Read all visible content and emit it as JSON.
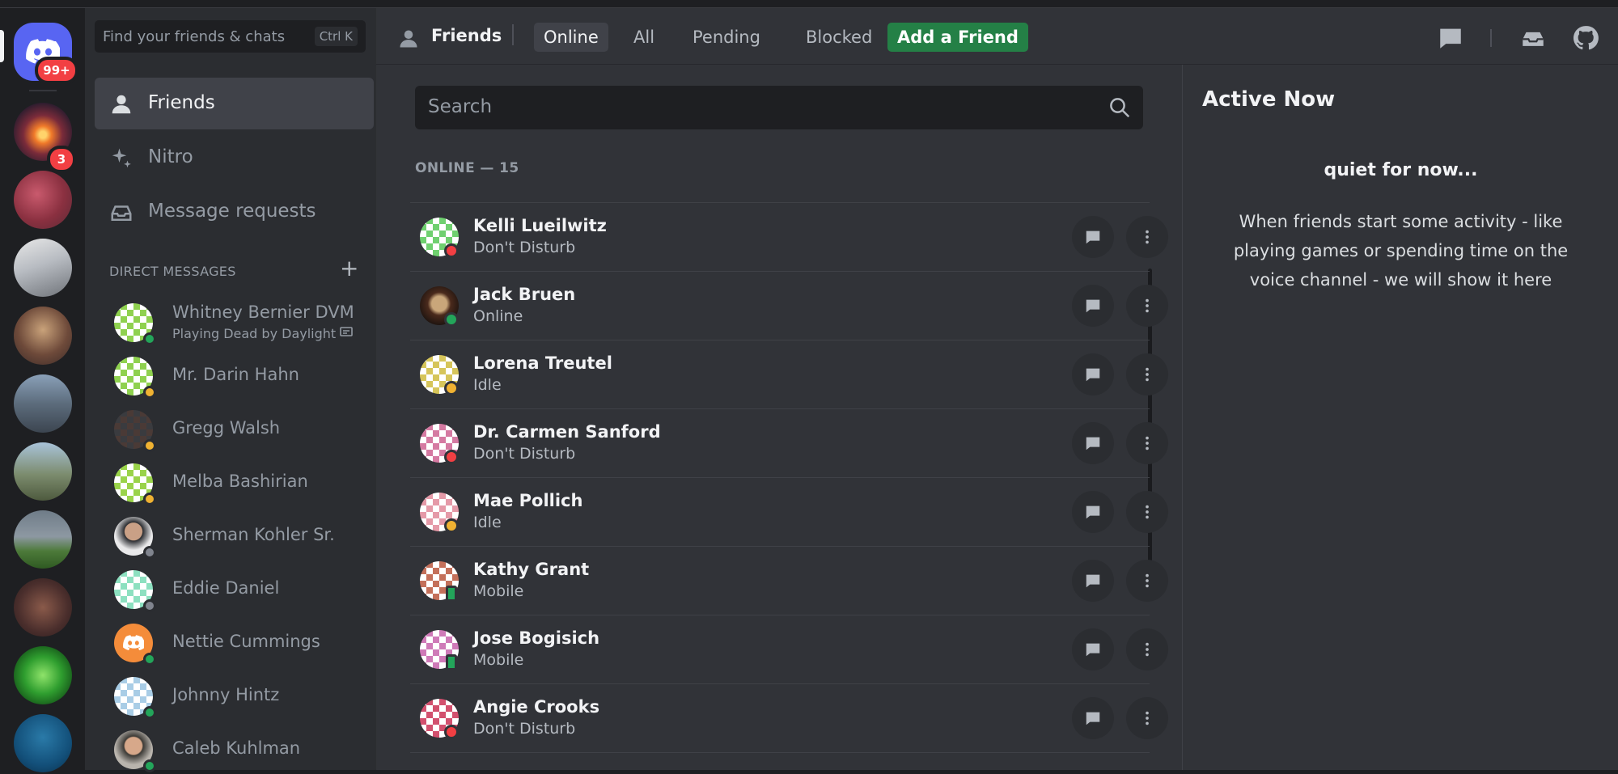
{
  "search": {
    "placeholder": "Find your friends & chats",
    "shortcut": "Ctrl K"
  },
  "rail": {
    "home_badge": "99+",
    "servers": [
      {
        "name": "server-sunset",
        "badge": "3"
      },
      {
        "name": "server-red-flowers"
      },
      {
        "name": "server-white-building"
      },
      {
        "name": "server-market"
      },
      {
        "name": "server-city"
      },
      {
        "name": "server-cliff"
      },
      {
        "name": "server-field"
      },
      {
        "name": "server-crowd"
      },
      {
        "name": "server-green"
      },
      {
        "name": "server-blue"
      }
    ]
  },
  "sidebar": {
    "nav": [
      {
        "label": "Friends",
        "icon": "person-icon"
      },
      {
        "label": "Nitro",
        "icon": "sparkle-icon"
      },
      {
        "label": "Message requests",
        "icon": "inbox-icon"
      }
    ],
    "dm_header": "DIRECT MESSAGES",
    "dms": [
      {
        "name": "Whitney Bernier DVM",
        "activity": "Playing Dead by Daylight",
        "status": "online"
      },
      {
        "name": "Mr. Darin Hahn",
        "status": "idle"
      },
      {
        "name": "Gregg Walsh",
        "status": "idle"
      },
      {
        "name": "Melba Bashirian",
        "status": "idle"
      },
      {
        "name": "Sherman Kohler Sr.",
        "status": "offline"
      },
      {
        "name": "Eddie Daniel",
        "status": "offline"
      },
      {
        "name": "Nettie Cummings",
        "status": "online"
      },
      {
        "name": "Johnny Hintz",
        "status": "online"
      },
      {
        "name": "Caleb Kuhlman",
        "status": "online"
      }
    ]
  },
  "topbar": {
    "title": "Friends",
    "tabs": [
      {
        "label": "Online",
        "active": true
      },
      {
        "label": "All"
      },
      {
        "label": "Pending"
      },
      {
        "label": "Blocked"
      },
      {
        "label": "Add a Friend",
        "accent": true
      }
    ],
    "right_icons": [
      "new-dm-icon",
      "inbox-icon",
      "github-icon"
    ]
  },
  "friends": {
    "search_placeholder": "Search",
    "online_header": "ONLINE — 15",
    "rows": [
      {
        "name": "Kelli Lueilwitz",
        "status": "Don't Disturb",
        "state": "dnd"
      },
      {
        "name": "Jack Bruen",
        "status": "Online",
        "state": "online"
      },
      {
        "name": "Lorena Treutel",
        "status": "Idle",
        "state": "idle"
      },
      {
        "name": "Dr. Carmen Sanford",
        "status": "Don't Disturb",
        "state": "dnd"
      },
      {
        "name": "Mae Pollich",
        "status": "Idle",
        "state": "idle"
      },
      {
        "name": "Kathy Grant",
        "status": "Mobile",
        "state": "mobile"
      },
      {
        "name": "Jose Bogisich",
        "status": "Mobile",
        "state": "mobile"
      },
      {
        "name": "Angie Crooks",
        "status": "Don't Disturb",
        "state": "dnd"
      }
    ]
  },
  "active_now": {
    "title": "Active Now",
    "headline": "quiet for now...",
    "description": "When friends start some activity - like playing games or spending time on the voice channel - we will show it here"
  },
  "colors": {
    "accent": "#5865f2",
    "online": "#23a55a",
    "idle": "#f0b232",
    "dnd": "#f23f43",
    "offline": "#80848e",
    "add_friend": "#248046"
  }
}
